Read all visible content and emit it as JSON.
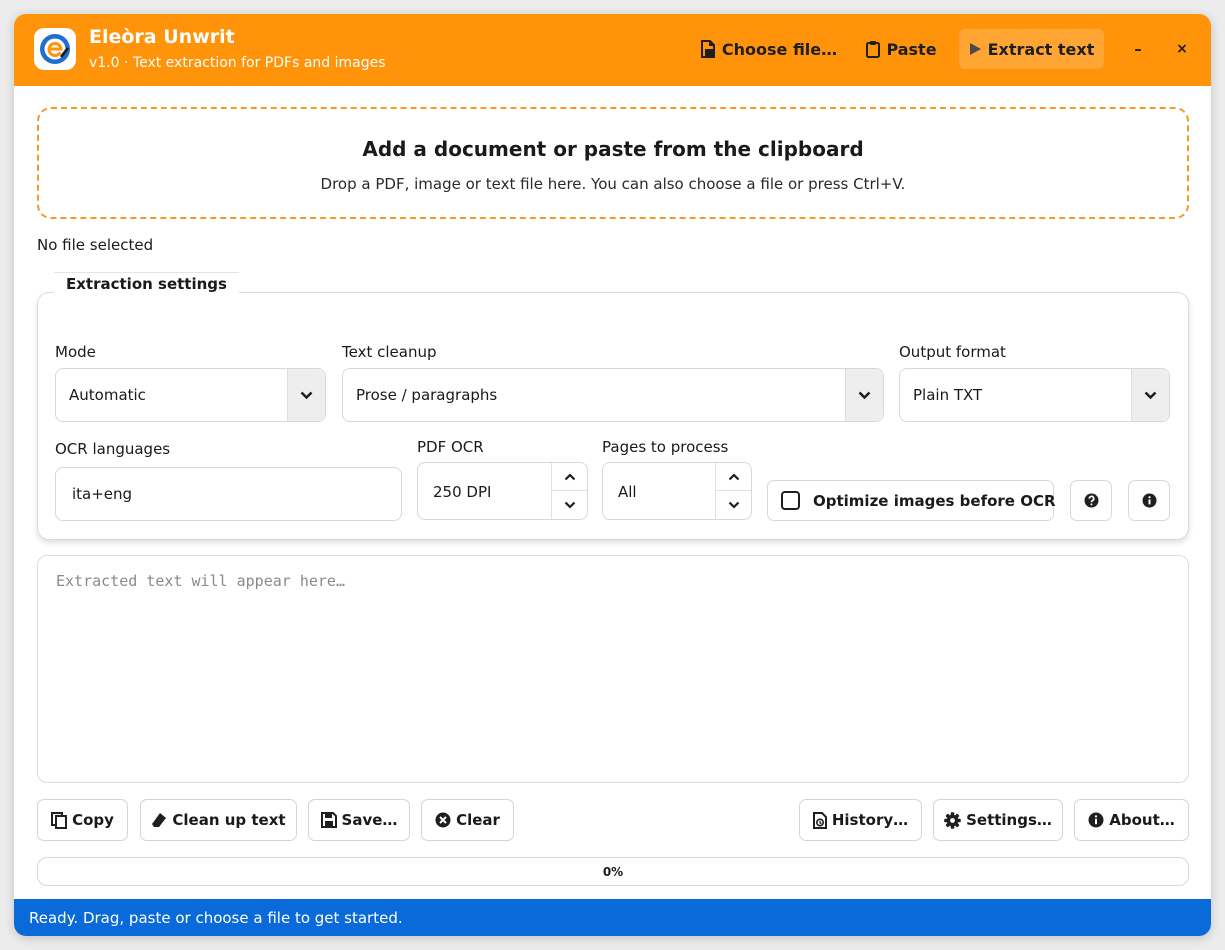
{
  "header": {
    "title": "Eleòra Unwrit",
    "subtitle": "v1.0 · Text extraction for PDFs and images",
    "choose_file": "Choose file…",
    "paste": "Paste",
    "extract": "Extract text",
    "minimize": "–",
    "close": "×",
    "accent_color": "#ff9309"
  },
  "dropzone": {
    "title": "Add a document or paste from the clipboard",
    "subtitle": "Drop a PDF, image or text file here. You can also choose a file or press Ctrl+V."
  },
  "file_status": "No file selected",
  "settings": {
    "legend": "Extraction settings",
    "mode": {
      "label": "Mode",
      "value": "Automatic"
    },
    "cleanup": {
      "label": "Text cleanup",
      "value": "Prose / paragraphs"
    },
    "format": {
      "label": "Output format",
      "value": "Plain TXT"
    },
    "ocr_languages": {
      "label": "OCR languages",
      "value": "ita+eng"
    },
    "pdf_ocr": {
      "label": "PDF OCR",
      "value": "250 DPI"
    },
    "pages": {
      "label": "Pages to process",
      "value": "All"
    },
    "optimize": {
      "label": "Optimize images before OCR",
      "checked": false
    },
    "help_icon": "question-circle-icon",
    "info_icon": "info-circle-icon"
  },
  "output": {
    "placeholder": "Extracted text will appear here…",
    "value": ""
  },
  "actions": {
    "copy": "Copy",
    "cleanup": "Clean up text",
    "save": "Save…",
    "clear": "Clear",
    "history": "History…",
    "settings": "Settings…",
    "about": "About…"
  },
  "progress": {
    "value": 0,
    "label": "0%"
  },
  "statusbar": {
    "text": "Ready. Drag, paste or choose a file to get started.",
    "color": "#0a6ad9"
  }
}
